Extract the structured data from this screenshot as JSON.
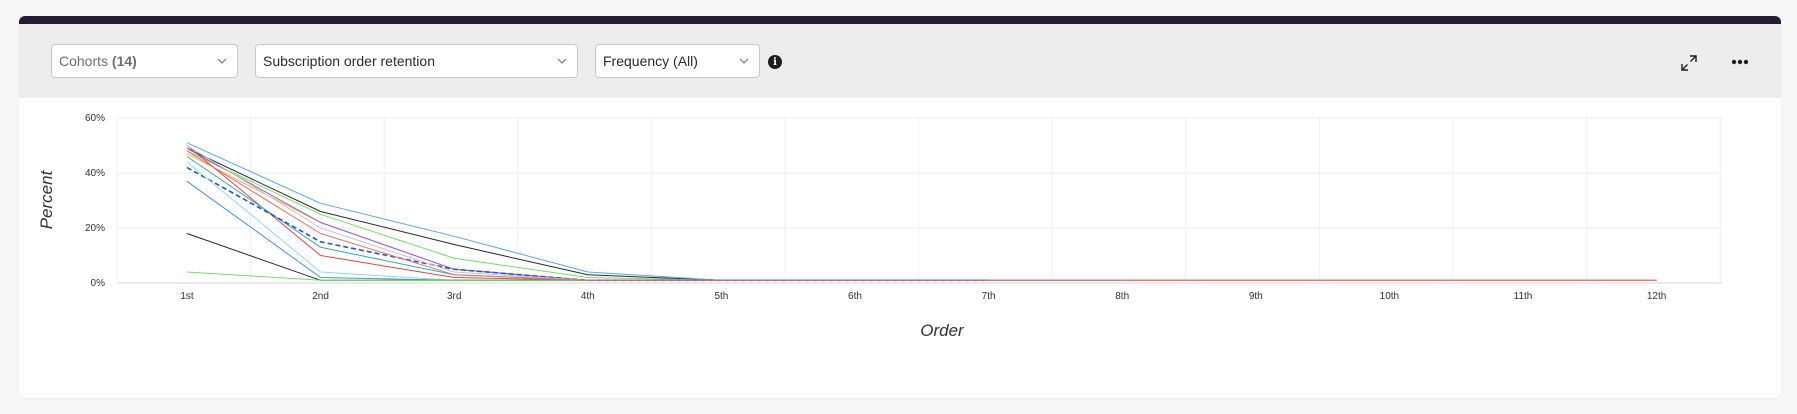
{
  "toolbar": {
    "cohorts_label": "Cohorts",
    "cohorts_count": "(14)",
    "metric_label": "Subscription order retention",
    "frequency_label": "Frequency (All)"
  },
  "chart_data": {
    "type": "line",
    "xlabel": "Order",
    "ylabel": "Percent",
    "categories": [
      "1st",
      "2nd",
      "3rd",
      "4th",
      "5th",
      "6th",
      "7th",
      "8th",
      "9th",
      "10th",
      "11th",
      "12th"
    ],
    "ylim": [
      0,
      60
    ],
    "yticks": [
      "0%",
      "20%",
      "40%",
      "60%"
    ],
    "ytick_values": [
      0,
      20,
      40,
      60
    ],
    "grid": true,
    "legend": "none",
    "series": [
      {
        "color": "#2a2a2a",
        "values": [
          49,
          26,
          14,
          3,
          1,
          1,
          1
        ]
      },
      {
        "color": "#5aa9e6",
        "values": [
          51,
          29,
          17,
          4,
          1,
          1,
          1
        ]
      },
      {
        "color": "#77dd66",
        "values": [
          48,
          25,
          9,
          2,
          1,
          1,
          1,
          1,
          1,
          1,
          1,
          1
        ]
      },
      {
        "color": "#f2b64a",
        "values": [
          47,
          22,
          5,
          1,
          1,
          1,
          1
        ]
      },
      {
        "color": "#e04848",
        "values": [
          50,
          10,
          2,
          1,
          1,
          1,
          1,
          1,
          1,
          1,
          1,
          1
        ]
      },
      {
        "color": "#3aa9b5",
        "values": [
          46,
          13,
          3,
          1,
          1,
          1,
          1,
          1
        ]
      },
      {
        "color": "#9b59d0",
        "values": [
          49,
          22,
          5,
          1,
          1,
          1,
          1
        ]
      },
      {
        "color": "#2458c9",
        "dashed": true,
        "values": [
          42,
          15,
          5,
          1,
          1,
          1,
          1
        ]
      },
      {
        "color": "#4f8fd8",
        "values": [
          37,
          2,
          1,
          1
        ]
      },
      {
        "color": "#8fdcea",
        "values": [
          44,
          4,
          1,
          1
        ]
      },
      {
        "color": "#2a2a2a",
        "values": [
          18,
          1,
          1,
          1
        ]
      },
      {
        "color": "#77dd66",
        "values": [
          4,
          1,
          1,
          1
        ]
      },
      {
        "color": "#c5c5c5",
        "values": [
          50,
          20,
          4,
          1
        ]
      },
      {
        "color": "#e87070",
        "values": [
          48,
          18,
          3,
          1,
          1,
          1,
          1,
          1,
          1,
          1,
          1,
          1
        ]
      }
    ]
  }
}
